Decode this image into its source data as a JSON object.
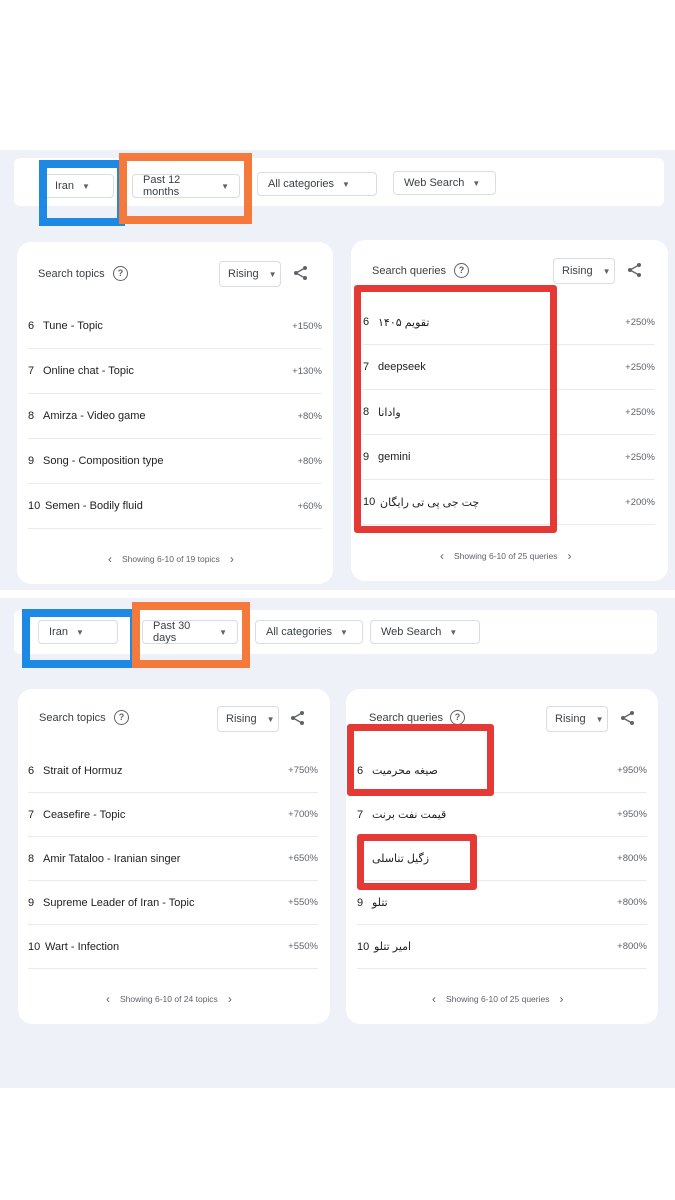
{
  "panels": [
    {
      "filters": {
        "region": "Iran",
        "time": "Past 12 months",
        "category": "All categories",
        "search_type": "Web Search"
      },
      "topics": {
        "title": "Search topics",
        "mode": "Rising",
        "rows": [
          {
            "rank": "6",
            "label": "Tune - Topic",
            "value": "+150%"
          },
          {
            "rank": "7",
            "label": "Online chat - Topic",
            "value": "+130%"
          },
          {
            "rank": "8",
            "label": "Amirza - Video game",
            "value": "+80%"
          },
          {
            "rank": "9",
            "label": "Song - Composition type",
            "value": "+80%"
          },
          {
            "rank": "10",
            "label": "Semen - Bodily fluid",
            "value": "+60%"
          }
        ],
        "pager": "Showing 6-10 of 19 topics"
      },
      "queries": {
        "title": "Search queries",
        "mode": "Rising",
        "rows": [
          {
            "rank": "6",
            "label": "تقویم ۱۴۰۵",
            "value": "+250%"
          },
          {
            "rank": "7",
            "label": "deepseek",
            "value": "+250%"
          },
          {
            "rank": "8",
            "label": "وادانا",
            "value": "+250%"
          },
          {
            "rank": "9",
            "label": "gemini",
            "value": "+250%"
          },
          {
            "rank": "10",
            "label": "چت جی پی تی رایگان",
            "value": "+200%"
          }
        ],
        "pager": "Showing 6-10 of 25 queries"
      }
    },
    {
      "filters": {
        "region": "Iran",
        "time": "Past 30 days",
        "category": "All categories",
        "search_type": "Web Search"
      },
      "topics": {
        "title": "Search topics",
        "mode": "Rising",
        "rows": [
          {
            "rank": "6",
            "label": "Strait of Hormuz",
            "value": "+750%"
          },
          {
            "rank": "7",
            "label": "Ceasefire - Topic",
            "value": "+700%"
          },
          {
            "rank": "8",
            "label": "Amir Tataloo - Iranian singer",
            "value": "+650%"
          },
          {
            "rank": "9",
            "label": "Supreme Leader of Iran - Topic",
            "value": "+550%"
          },
          {
            "rank": "10",
            "label": "Wart - Infection",
            "value": "+550%"
          }
        ],
        "pager": "Showing 6-10 of 24 topics"
      },
      "queries": {
        "title": "Search queries",
        "mode": "Rising",
        "rows": [
          {
            "rank": "6",
            "label": "صیغه محرمیت",
            "value": "+950%"
          },
          {
            "rank": "7",
            "label": "قیمت نفت برنت",
            "value": "+950%"
          },
          {
            "rank": "8",
            "label": "زگیل تناسلی",
            "value": "+800%"
          },
          {
            "rank": "9",
            "label": "تتلو",
            "value": "+800%"
          },
          {
            "rank": "10",
            "label": "امیر تتلو",
            "value": "+800%"
          }
        ],
        "pager": "Showing 6-10 of 25 queries"
      }
    }
  ],
  "colors": {
    "highlight_blue": "#1e88e5",
    "highlight_orange": "#f5793b",
    "highlight_red": "#e53935",
    "background": "#eef1f8"
  }
}
